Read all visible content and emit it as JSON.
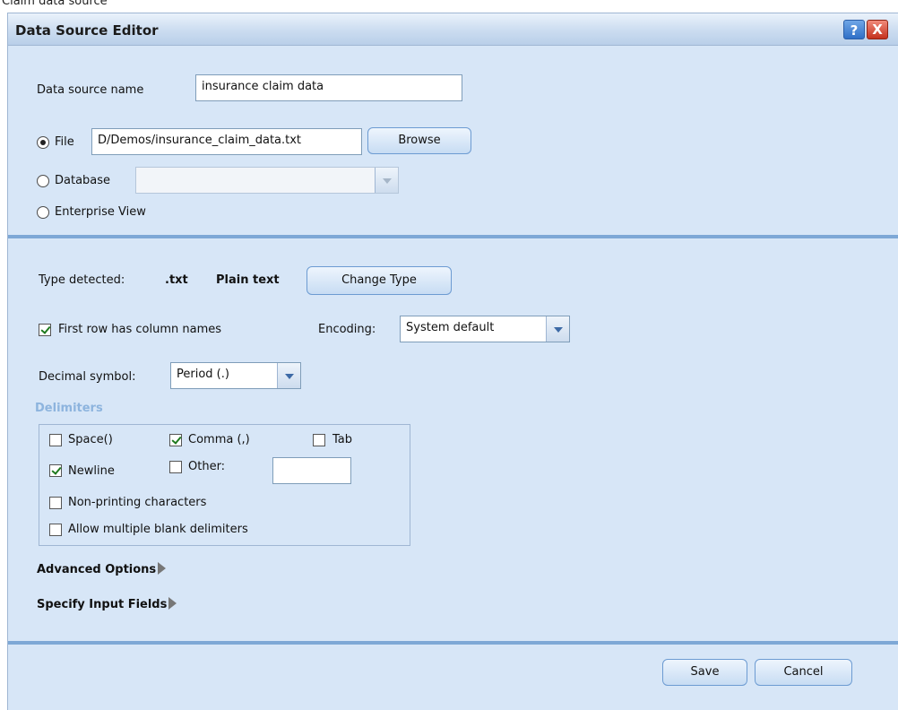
{
  "page_caption": "Claim data source",
  "dialog": {
    "title": "Data Source Editor",
    "help_label": "?",
    "close_label": "X"
  },
  "source": {
    "name_label": "Data source name",
    "name_value": "insurance claim data",
    "file_label": "File",
    "file_path": "D/Demos/insurance_claim_data.txt",
    "browse_label": "Browse",
    "database_label": "Database",
    "database_value": "",
    "enterprise_label": "Enterprise View",
    "selected": "File"
  },
  "type": {
    "detected_label": "Type detected:",
    "extension": ".txt",
    "kind": "Plain text",
    "change_label": "Change Type"
  },
  "options": {
    "first_row_label": "First row has column names",
    "first_row_checked": true,
    "encoding_label": "Encoding:",
    "encoding_value": "System default",
    "decimal_label": "Decimal symbol:",
    "decimal_value": "Period (.)"
  },
  "delimiters": {
    "title": "Delimiters",
    "space_label": "Space()",
    "comma_label": "Comma (,)",
    "tab_label": "Tab",
    "newline_label": "Newline",
    "other_label": "Other:",
    "other_value": "",
    "nonprinting_label": "Non-printing characters",
    "multiple_blank_label": "Allow multiple blank delimiters",
    "checked": [
      "Comma (,)",
      "Newline"
    ]
  },
  "sections": {
    "advanced_label": "Advanced Options",
    "input_fields_label": "Specify Input Fields"
  },
  "footer": {
    "save_label": "Save",
    "cancel_label": "Cancel"
  },
  "icons": [
    "help-icon",
    "close-icon",
    "dropdown-arrow-icon",
    "expand-arrow-icon"
  ]
}
